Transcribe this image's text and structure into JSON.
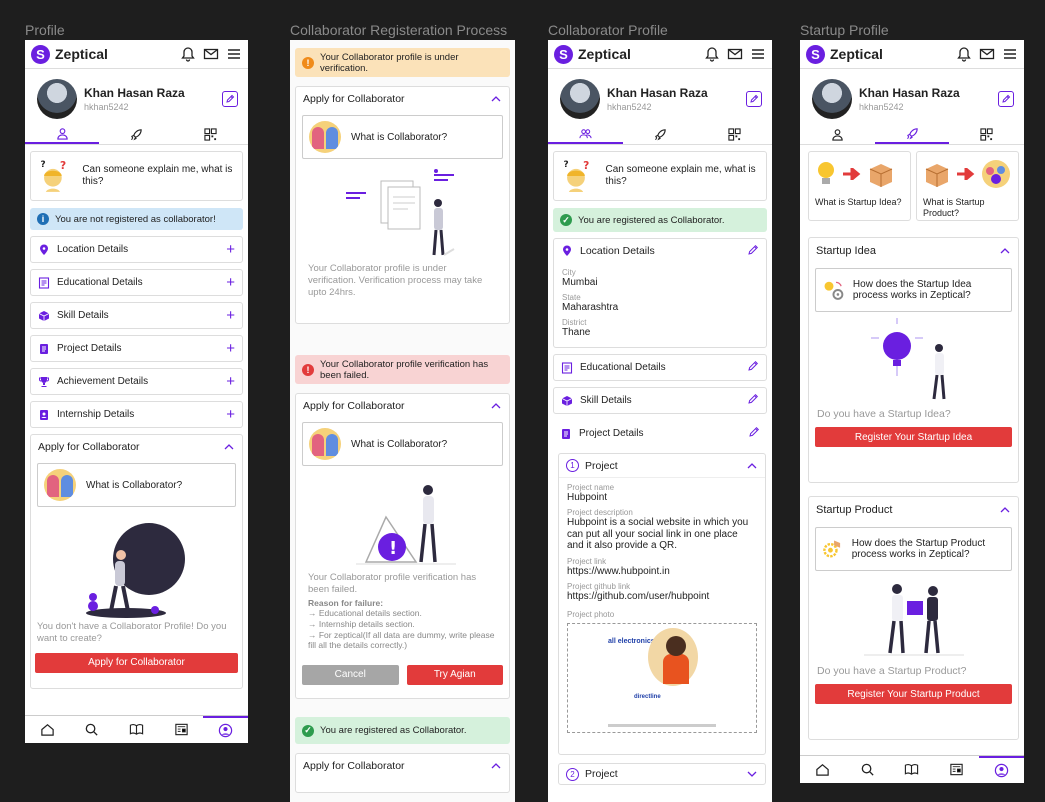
{
  "frames": {
    "profile": "Profile",
    "registration": "Collaborator Registeration Process",
    "collab_profile": "Collaborator Profile",
    "startup_profile": "Startup Profile"
  },
  "brand": "Zeptical",
  "user": {
    "name": "Khan Hasan Raza",
    "username": "hkhan5242"
  },
  "question": "Can someone explain me, what is  this?",
  "screen1": {
    "alert": "You are not registered as collaborator!",
    "sections": [
      "Location Details",
      "Educational Details",
      "Skill Details",
      "Project Details",
      "Achievement Details",
      "Internship Details"
    ],
    "apply_header": "Apply for Collaborator",
    "what_is": "What is Collaborator?",
    "empty_text": "You don't have a Collaborator Profile! Do you want to create?",
    "apply_button": "Apply for Collaborator"
  },
  "screen2": {
    "pending_alert": "Your Collaborator profile is under verification.",
    "apply_header": "Apply for Collaborator",
    "what_is": "What is Collaborator?",
    "pending_text": "Your Collaborator profile is under verification. Verification process may take upto 24hrs.",
    "failed_alert": "Your Collaborator profile verification has been failed.",
    "failed_text": "Your Collaborator profile verification has been failed.",
    "reason_title": "Reason for failure:",
    "reasons": [
      "→ Educational details section.",
      "→ Internship details section.",
      "→ For zeptical(If all data are dummy, write please fill all the details correctly.)"
    ],
    "cancel": "Cancel",
    "try_again": "Try Agian",
    "success_alert": "You are registered as Collaborator.",
    "apply_header_2": "Apply for Collaborator"
  },
  "screen3": {
    "alert": "You are registered as Collaborator.",
    "location_header": "Location Details",
    "location": [
      {
        "label": "City",
        "value": "Mumbai"
      },
      {
        "label": "State",
        "value": "Maharashtra"
      },
      {
        "label": "District",
        "value": "Thane"
      }
    ],
    "educational": "Educational Details",
    "skill": "Skill Details",
    "project_details": "Project Details",
    "project_num": "1",
    "project_title": "Project",
    "project_fields": [
      {
        "label": "Project name",
        "value": "Hubpoint"
      },
      {
        "label": "Project description",
        "value": "Hubpoint is a social website in which you can put all your social link in one place  and it also provide a QR."
      },
      {
        "label": "Project link",
        "value": "https://www.hubpoint.in"
      },
      {
        "label": "Project github link",
        "value": "https://github.com/user/hubpoint"
      }
    ],
    "photo_label": "Project photo",
    "photo_text_1": "all electronics",
    "photo_text_2": "directline",
    "project2_num": "2",
    "project2_title": "Project"
  },
  "screen4": {
    "card1": "What is Startup Idea?",
    "card2": "What is Startup Product?",
    "idea_header": "Startup Idea",
    "idea_q": "How does the Startup Idea process works in Zeptical?",
    "idea_prompt": "Do you have a Startup Idea?",
    "idea_button": "Register Your Startup Idea",
    "product_header": "Startup Product",
    "product_q": "How does the Startup Product process works in Zeptical?",
    "product_prompt": "Do you have a Startup Product?",
    "product_button": "Register Your Startup Product"
  },
  "colors": {
    "accent": "#6a1fe0",
    "danger": "#e23b3b",
    "success": "#2e9b4e",
    "info": "#cfe6f7",
    "warning": "#fbe2b9"
  }
}
